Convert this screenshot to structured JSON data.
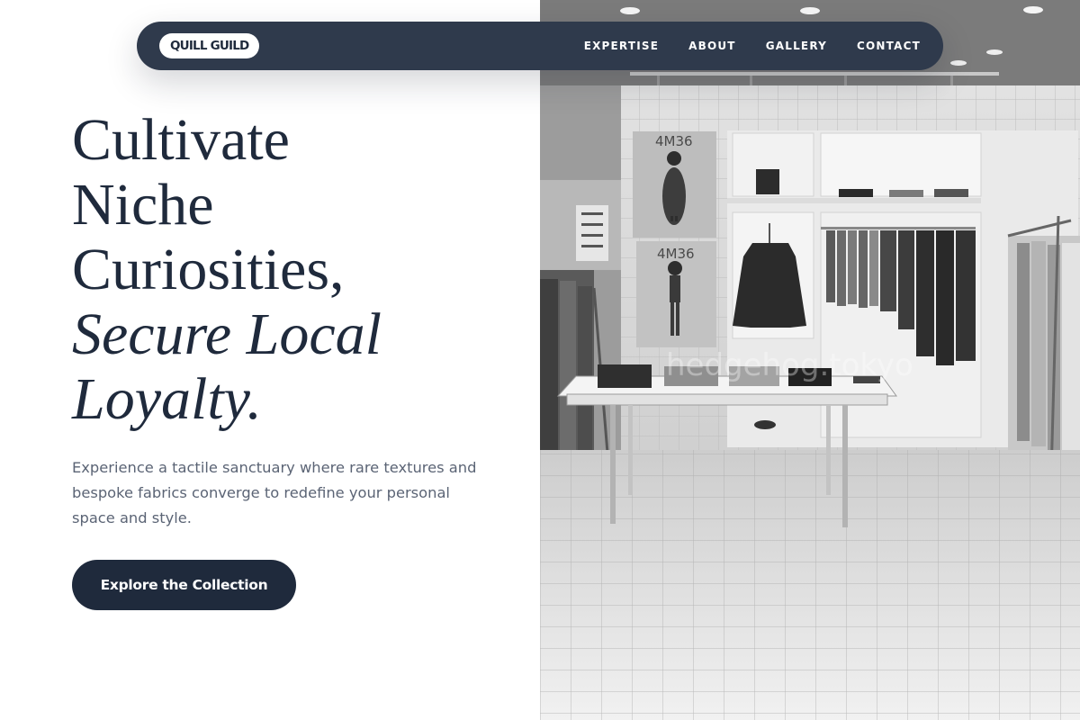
{
  "brand": {
    "logo_text": "QUILL GUILD"
  },
  "nav": {
    "links": [
      "EXPERTISE",
      "ABOUT",
      "GALLERY",
      "CONTACT"
    ]
  },
  "hero": {
    "headline_lines": [
      "Cultivate",
      "Niche",
      "Curiosities,"
    ],
    "headline_italic_lines": [
      "Secure Local",
      "Loyalty."
    ],
    "subtext": "Experience a tactile sanctuary where rare textures and bespoke fabrics converge to redefine your personal space and style.",
    "cta_label": "Explore the Collection",
    "image": {
      "poster_text": [
        "4M36",
        "4M36"
      ],
      "watermark": "hedgehog.tokyo"
    }
  },
  "colors": {
    "navy": "#1f2a3c",
    "nav_bg": "#2f3a4c",
    "body_text": "#5b6475",
    "background": "#ffffff"
  }
}
